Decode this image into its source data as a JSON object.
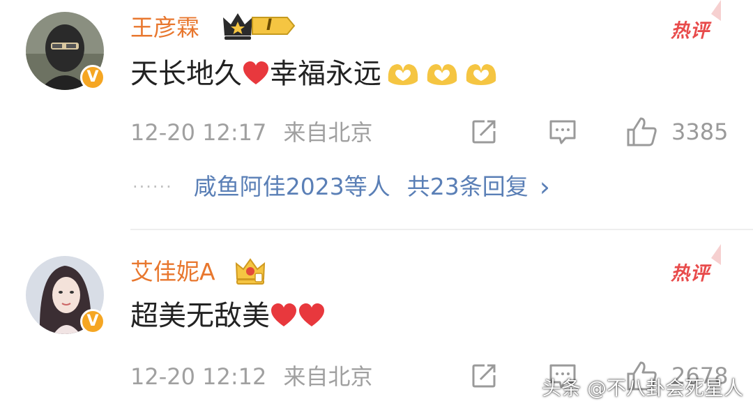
{
  "comments": [
    {
      "username": "王彦霖",
      "level_badge": "I",
      "hot_label": "热评",
      "text": "天长地久",
      "text_after_heart": "幸福永远",
      "timestamp": "12-20 12:17",
      "location": "来自北京",
      "likes": "3385"
    },
    {
      "username": "艾佳妮A",
      "hot_label": "热评",
      "text": "超美无敌美",
      "timestamp": "12-20 12:12",
      "location": "来自北京",
      "likes": "2678"
    }
  ],
  "replies": {
    "dots": "······",
    "who": "咸鱼阿佳2023等人",
    "count": "共23条回复",
    "chevron": "›"
  },
  "watermark": "头条 @不八卦会死星人",
  "colors": {
    "username": "#e8772e",
    "hot": "#e84b4b",
    "link": "#5a7fb6",
    "meta": "#a0a0a0",
    "heart": "#e8383d",
    "gold": "#f5c542"
  },
  "icons": [
    "verified-v-icon",
    "crown-icon",
    "share-icon",
    "comment-icon",
    "like-icon",
    "heart-icon",
    "heart-hands-icon",
    "chevron-right-icon"
  ]
}
